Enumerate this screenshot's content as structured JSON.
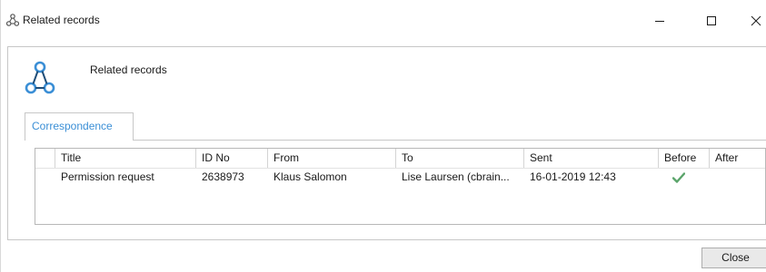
{
  "window": {
    "title": "Related records"
  },
  "header": {
    "title": "Related records"
  },
  "tabs": [
    {
      "label": "Correspondence"
    }
  ],
  "table": {
    "columns": [
      "Title",
      "ID No",
      "From",
      "To",
      "Sent",
      "Before",
      "After"
    ],
    "rows": [
      {
        "title": "Permission request",
        "id_no": "2638973",
        "from": "Klaus Salomon",
        "to": "Lise Laursen (cbrain...",
        "sent": "16-01-2019 12:43",
        "before": true,
        "after": false
      }
    ]
  },
  "footer": {
    "close_label": "Close"
  },
  "colors": {
    "accent": "#3b8fd6",
    "check": "#5aa46a"
  }
}
